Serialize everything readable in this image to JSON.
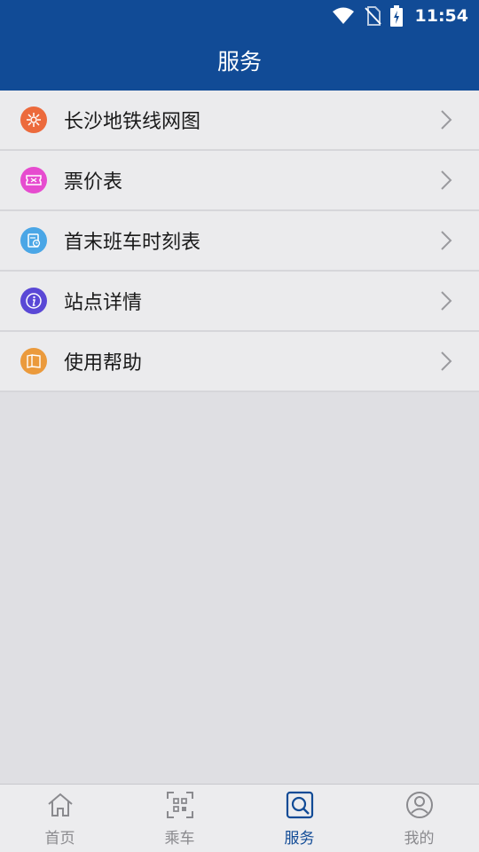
{
  "status_bar": {
    "time": "11:54",
    "icons": [
      "wifi-icon",
      "no-sim-icon",
      "battery-charging-icon"
    ]
  },
  "header": {
    "title": "服务"
  },
  "menu": {
    "items": [
      {
        "label": "长沙地铁线网图",
        "icon": "metro-map-icon",
        "color": "#ec6a3c"
      },
      {
        "label": "票价表",
        "icon": "ticket-icon",
        "color": "#e64bcf"
      },
      {
        "label": "首末班车时刻表",
        "icon": "schedule-icon",
        "color": "#4aa6e6"
      },
      {
        "label": "站点详情",
        "icon": "info-icon",
        "color": "#5a48d6"
      },
      {
        "label": "使用帮助",
        "icon": "help-book-icon",
        "color": "#eb9a3c"
      }
    ]
  },
  "tabbar": {
    "tabs": [
      {
        "label": "首页",
        "icon": "home-icon",
        "active": false
      },
      {
        "label": "乘车",
        "icon": "qr-scan-icon",
        "active": false
      },
      {
        "label": "服务",
        "icon": "service-search-icon",
        "active": true
      },
      {
        "label": "我的",
        "icon": "profile-icon",
        "active": false
      }
    ]
  },
  "colors": {
    "primary": "#114b96",
    "background": "#dfdfe3",
    "inactive": "#8a8a8e"
  }
}
